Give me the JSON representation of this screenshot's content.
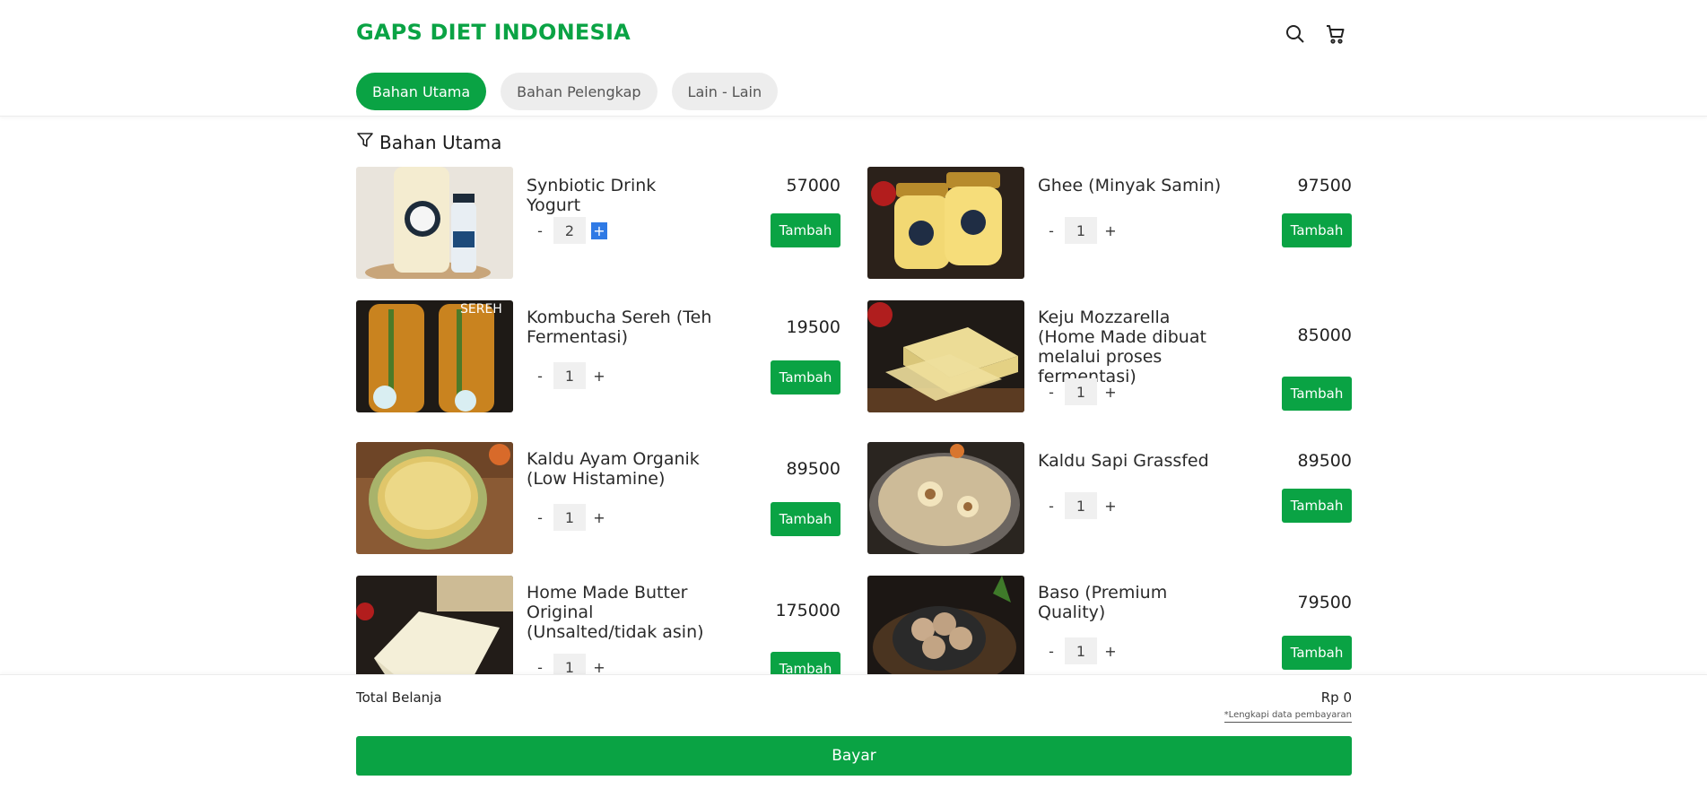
{
  "header": {
    "brand": "GAPS DIET INDONESIA"
  },
  "tabs": [
    {
      "label": "Bahan Utama",
      "active": true
    },
    {
      "label": "Bahan Pelengkap",
      "active": false
    },
    {
      "label": "Lain - Lain",
      "active": false
    }
  ],
  "section": {
    "title": "Bahan Utama"
  },
  "products": [
    {
      "name": "Synbiotic Drink Yogurt",
      "price": "57000",
      "qty": "2",
      "add_label": "Tambah",
      "minus": "-",
      "plus": "+"
    },
    {
      "name": "Ghee (Minyak Samin)",
      "price": "97500",
      "qty": "1",
      "add_label": "Tambah",
      "minus": "-",
      "plus": "+"
    },
    {
      "name": "Kombucha Sereh (Teh Fermentasi)",
      "price": "19500",
      "qty": "1",
      "add_label": "Tambah",
      "minus": "-",
      "plus": "+"
    },
    {
      "name": "Keju Mozzarella (Home Made dibuat melalui proses fermentasi)",
      "price": "85000",
      "qty": "1",
      "add_label": "Tambah",
      "minus": "-",
      "plus": "+"
    },
    {
      "name": "Kaldu Ayam Organik (Low Histamine)",
      "price": "89500",
      "qty": "1",
      "add_label": "Tambah",
      "minus": "-",
      "plus": "+"
    },
    {
      "name": "Kaldu Sapi Grassfed",
      "price": "89500",
      "qty": "1",
      "add_label": "Tambah",
      "minus": "-",
      "plus": "+"
    },
    {
      "name": "Home Made Butter Original (Unsalted/tidak asin)",
      "price": "175000",
      "qty": "1",
      "add_label": "Tambah",
      "minus": "-",
      "plus": "+"
    },
    {
      "name": "Baso (Premium Quality)",
      "price": "79500",
      "qty": "1",
      "add_label": "Tambah",
      "minus": "-",
      "plus": "+"
    }
  ],
  "footer": {
    "total_label": "Total Belanja",
    "total_value": "Rp 0",
    "note": "*Lengkapi data pembayaran",
    "pay_label": "Bayar"
  },
  "colors": {
    "accent": "#0aa344",
    "selection": "#2f7ae5"
  },
  "icons": {
    "search": "search-icon",
    "cart": "cart-icon",
    "filter": "filter-icon"
  }
}
